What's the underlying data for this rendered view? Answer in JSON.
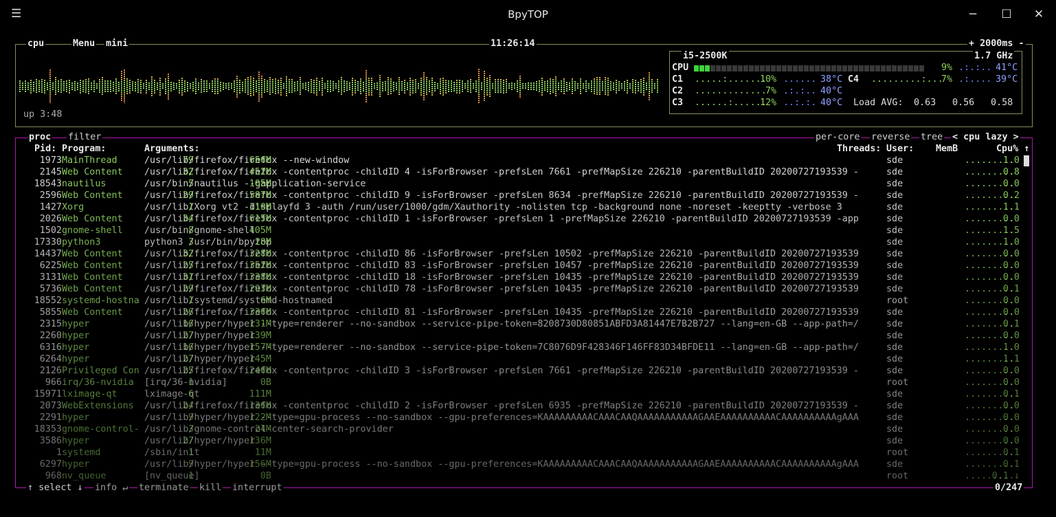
{
  "window": {
    "title": "BpyTOP"
  },
  "cpu_box": {
    "tab_cpu": "cpu",
    "tab_menu": "Menu",
    "tab_mini": "mini",
    "clock": "11:26:14",
    "interval": "+ 2000ms -",
    "uptime": "up 3:48",
    "model": "i5-2500K",
    "freq": "1.7 GHz",
    "cpu_label": "CPU",
    "cpu_pct": "9%",
    "cpu_temp": "41°C",
    "cores": [
      {
        "name": "C1",
        "pct": "10%",
        "temp": "38°C"
      },
      {
        "name": "C2",
        "pct": "7%",
        "temp": "40°C"
      },
      {
        "name": "C3",
        "pct": "12%",
        "temp": "40°C"
      },
      {
        "name": "C4",
        "pct": "7%",
        "temp": "39°C"
      }
    ],
    "load_label": "Load AVG:",
    "load": [
      "0.63",
      "0.56",
      "0.58"
    ]
  },
  "proc_box": {
    "tab_proc": "proc",
    "tab_filter": "filter",
    "opt_percore": "per-core",
    "opt_reverse": "reverse",
    "opt_tree": "tree",
    "sort": "< cpu lazy >",
    "headers": {
      "pid": "Pid:",
      "program": "Program:",
      "args": "Arguments:",
      "threads": "Threads:",
      "user": "User:",
      "mem": "MemB",
      "cpu": "Cpu% ↑"
    },
    "rows": [
      {
        "pid": "1973",
        "prog": "MainThread",
        "args": "/usr/lib/firefox/firefox --new-window",
        "thr": "79",
        "user": "sde",
        "mem": "656M",
        "cpu": "1.0"
      },
      {
        "pid": "2145",
        "prog": "Web Content",
        "args": "/usr/lib/firefox/firefox -contentproc -childID 4 -isForBrowser -prefsLen 7661 -prefMapSize 226210 -parentBuildID 20200727193539 -",
        "thr": "32",
        "user": "sde",
        "mem": "452M",
        "cpu": "0.8"
      },
      {
        "pid": "18543",
        "prog": "nautilus",
        "args": "/usr/bin/nautilus --gapplication-service",
        "thr": "5",
        "user": "sde",
        "mem": "105M",
        "cpu": "0.0"
      },
      {
        "pid": "2596",
        "prog": "Web Content",
        "args": "/usr/lib/firefox/firefox -contentproc -childID 9 -isForBrowser -prefsLen 8634 -prefMapSize 226210 -parentBuildID 20200727193539 -",
        "thr": "29",
        "user": "sde",
        "mem": "587M",
        "cpu": "0.2"
      },
      {
        "pid": "1427",
        "prog": "Xorg",
        "args": "/usr/lib/Xorg vt2 -displayfd 3 -auth /run/user/1000/gdm/Xauthority -nolisten tcp -background none -noreset -keeptty -verbose 3",
        "thr": "1",
        "user": "sde",
        "mem": "110M",
        "cpu": "1.1"
      },
      {
        "pid": "2026",
        "prog": "Web Content",
        "args": "/usr/lib/firefox/firefox -contentproc -childID 1 -isForBrowser -prefsLen 1 -prefMapSize 226210 -parentBuildID 20200727193539 -app",
        "thr": "34",
        "user": "sde",
        "mem": "615M",
        "cpu": "0.0"
      },
      {
        "pid": "1502",
        "prog": "gnome-shell",
        "args": "/usr/bin/gnome-shell",
        "thr": "8",
        "user": "sde",
        "mem": "405M",
        "cpu": "1.5"
      },
      {
        "pid": "17330",
        "prog": "python3",
        "args": "python3 /usr/bin/bpytop",
        "thr": "3",
        "user": "sde",
        "mem": "28M",
        "cpu": "1.0"
      },
      {
        "pid": "14437",
        "prog": "Web Content",
        "args": "/usr/lib/firefox/firefox -contentproc -childID 86 -isForBrowser -prefsLen 10502 -prefMapSize 226210 -parentBuildID 20200727193539",
        "thr": "32",
        "user": "sde",
        "mem": "328M",
        "cpu": "0.0"
      },
      {
        "pid": "6225",
        "prog": "Web Content",
        "args": "/usr/lib/firefox/firefox -contentproc -childID 83 -isForBrowser -prefsLen 10457 -prefMapSize 226210 -parentBuildID 20200727193539",
        "thr": "25",
        "user": "sde",
        "mem": "352M",
        "cpu": "0.0"
      },
      {
        "pid": "3131",
        "prog": "Web Content",
        "args": "/usr/lib/firefox/firefox -contentproc -childID 18 -isForBrowser -prefsLen 10435 -prefMapSize 226210 -parentBuildID 20200727193539",
        "thr": "31",
        "user": "sde",
        "mem": "338M",
        "cpu": "0.0"
      },
      {
        "pid": "5736",
        "prog": "Web Content",
        "args": "/usr/lib/firefox/firefox -contentproc -childID 78 -isForBrowser -prefsLen 10435 -prefMapSize 226210 -parentBuildID 20200727193539",
        "thr": "29",
        "user": "sde",
        "mem": "293M",
        "cpu": "0.1"
      },
      {
        "pid": "18552",
        "prog": "systemd-hostna",
        "args": "/usr/lib/systemd/systemd-hostnamed",
        "thr": "1",
        "user": "root",
        "mem": "6M",
        "cpu": "0.0"
      },
      {
        "pid": "5855",
        "prog": "Web Content",
        "args": "/usr/lib/firefox/firefox -contentproc -childID 81 -isForBrowser -prefsLen 10435 -prefMapSize 226210 -parentBuildID 20200727193539",
        "thr": "26",
        "user": "sde",
        "mem": "336M",
        "cpu": "0.0"
      },
      {
        "pid": "2315",
        "prog": "hyper",
        "args": "/usr/lib/hyper/hyper --type=renderer --no-sandbox --service-pipe-token=8208730D80851ABFD3A81447E7B2B727 --lang=en-GB --app-path=/",
        "thr": "16",
        "user": "sde",
        "mem": "131M",
        "cpu": "0.1"
      },
      {
        "pid": "2260",
        "prog": "hyper",
        "args": "/usr/lib/hyper/hyper",
        "thr": "27",
        "user": "sde",
        "mem": "139M",
        "cpu": "0.0"
      },
      {
        "pid": "6316",
        "prog": "hyper",
        "args": "/usr/lib/hyper/hyper --type=renderer --no-sandbox --service-pipe-token=7C8076D9F428346F146FF83D34BFDE11 --lang=en-GB --app-path=/",
        "thr": "16",
        "user": "sde",
        "mem": "157M",
        "cpu": "1.0"
      },
      {
        "pid": "6264",
        "prog": "hyper",
        "args": "/usr/lib/hyper/hyper",
        "thr": "27",
        "user": "sde",
        "mem": "145M",
        "cpu": "1.1"
      },
      {
        "pid": "2126",
        "prog": "Privileged Con",
        "args": "/usr/lib/firefox/firefox -contentproc -childID 3 -isForBrowser -prefsLen 7661 -prefMapSize 226210 -parentBuildID 20200727193539 -",
        "thr": "25",
        "user": "sde",
        "mem": "246M",
        "cpu": "0.0"
      },
      {
        "pid": "966",
        "prog": "irq/36-nvidia",
        "args": "[irq/36-nvidia]",
        "thr": "1",
        "user": "root",
        "mem": "0B",
        "cpu": "0.0"
      },
      {
        "pid": "15971",
        "prog": "lximage-qt",
        "args": "lximage-qt",
        "thr": "6",
        "user": "sde",
        "mem": "111M",
        "cpu": "0.1"
      },
      {
        "pid": "2073",
        "prog": "WebExtensions",
        "args": "/usr/lib/firefox/firefox -contentproc -childID 2 -isForBrowser -prefsLen 6935 -prefMapSize 226210 -parentBuildID 20200727193539 -",
        "thr": "24",
        "user": "sde",
        "mem": "136M",
        "cpu": "0.0"
      },
      {
        "pid": "2291",
        "prog": "hyper",
        "args": "/usr/lib/hyper/hyper --type=gpu-process --no-sandbox --gpu-preferences=KAAAAAAAAACAAACAAQAAAAAAAAAAAGAAEAAAAAAAAAACAAAAAAAAAAgAAA",
        "thr": "9",
        "user": "sde",
        "mem": "122M",
        "cpu": "0.0"
      },
      {
        "pid": "18353",
        "prog": "gnome-control-",
        "args": "/usr/lib/gnome-control-center-search-provider",
        "thr": "3",
        "user": "sde",
        "mem": "24M",
        "cpu": "0.0"
      },
      {
        "pid": "3586",
        "prog": "hyper",
        "args": "/usr/lib/hyper/hyper",
        "thr": "27",
        "user": "sde",
        "mem": "136M",
        "cpu": "0.0"
      },
      {
        "pid": "1",
        "prog": "systemd",
        "args": "/sbin/init",
        "thr": "1",
        "user": "root",
        "mem": "11M",
        "cpu": "0.1"
      },
      {
        "pid": "6297",
        "prog": "hyper",
        "args": "/usr/lib/hyper/hyper --type=gpu-process --no-sandbox --gpu-preferences=KAAAAAAAAACAAACAAQAAAAAAAAAAAGAAEAAAAAAAAAACAAAAAAAAAAgAAA",
        "thr": "9",
        "user": "sde",
        "mem": "156M",
        "cpu": "0.1"
      },
      {
        "pid": "968",
        "prog": "nv_queue",
        "args": "[nv_queue]",
        "thr": "1",
        "user": "root",
        "mem": "0B",
        "cpu": "0.1 ↓"
      }
    ],
    "footer": {
      "select": "↑ select ↓",
      "info": "info ↵",
      "terminate": "terminate",
      "kill": "kill",
      "interrupt": "interrupt",
      "count": "0/247"
    }
  }
}
